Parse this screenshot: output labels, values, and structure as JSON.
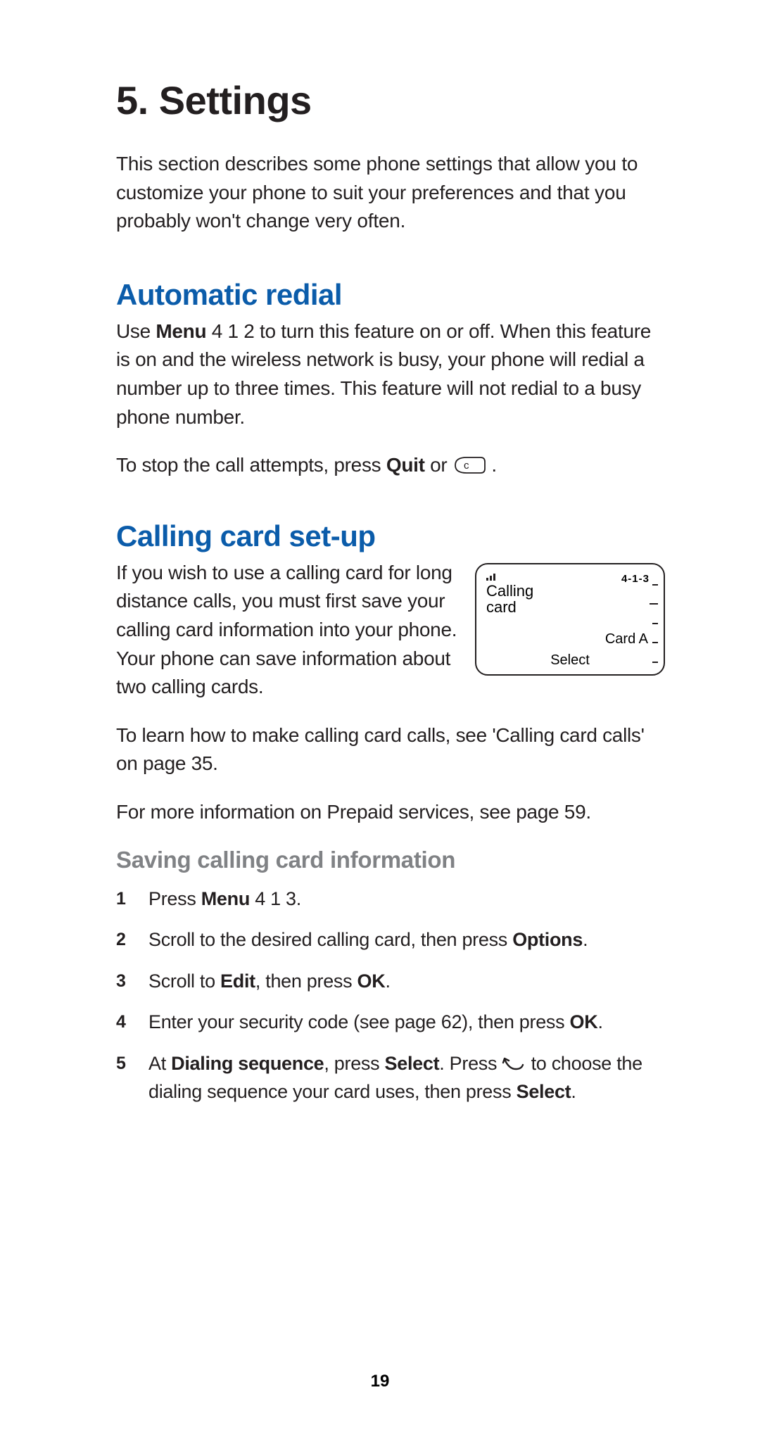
{
  "chapter": {
    "number": "5.",
    "title": "Settings"
  },
  "intro": "This section describes some phone settings that allow you to customize your phone to suit your preferences and that you probably won't change very often.",
  "section1": {
    "heading": "Automatic redial",
    "p1_pre": "Use ",
    "p1_bold": "Menu",
    "p1_post": " 4 1 2 to turn this feature on or off. When this feature is on and the wireless network is busy, your phone will redial a number up to three times. This feature will not redial to a busy phone number.",
    "p2_pre": "To stop the call attempts, press ",
    "p2_bold": "Quit",
    "p2_mid": " or ",
    "p2_post": " ."
  },
  "section2": {
    "heading": "Calling card set-up",
    "p1": "If you wish to use a calling card for long distance calls, you must first save your calling card information into your phone. Your phone can save information about two calling cards.",
    "p2": "To learn how to make calling card calls, see 'Calling card calls' on page 35.",
    "p3": "For more information on Prepaid services, see page 59."
  },
  "phone_screen": {
    "menu_index": "4-1-3",
    "title_line": "Calling\ncard",
    "current": "Card A",
    "softkey": "Select"
  },
  "subsection": {
    "heading": "Saving calling card information",
    "steps": {
      "s1_pre": "Press ",
      "s1_b": "Menu",
      "s1_post": " 4 1 3.",
      "s2_pre": "Scroll to the desired calling card, then press ",
      "s2_b": "Options",
      "s2_post": ".",
      "s3_pre": "Scroll to ",
      "s3_b1": "Edit",
      "s3_mid": ", then press ",
      "s3_b2": "OK",
      "s3_post": ".",
      "s4_pre": "Enter your security code (see page 62), then press ",
      "s4_b": "OK",
      "s4_post": ".",
      "s5_pre": "At ",
      "s5_b1": "Dialing sequence",
      "s5_mid1": ", press ",
      "s5_b2": "Select",
      "s5_mid2": ". Press ",
      "s5_mid3": " to choose the dialing sequence your card uses, then press ",
      "s5_b3": "Select",
      "s5_post": "."
    }
  },
  "page_number": "19"
}
